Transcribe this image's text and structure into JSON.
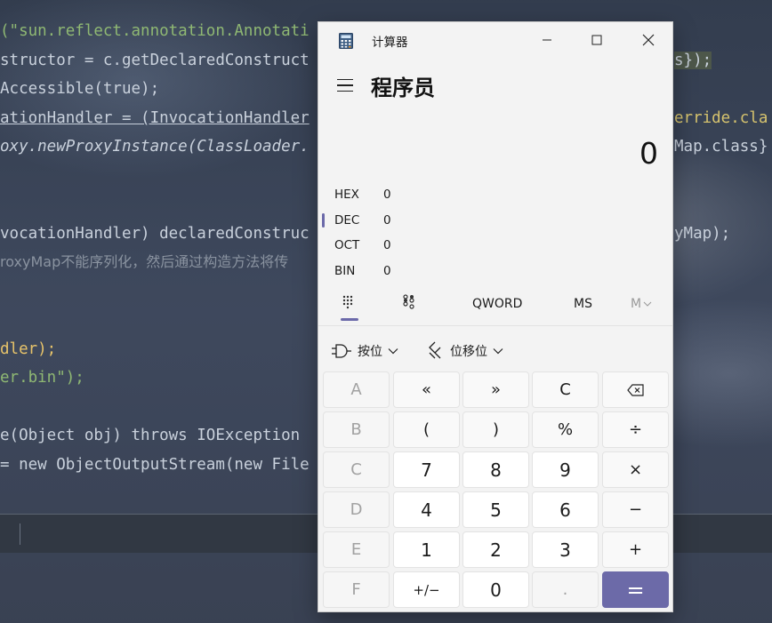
{
  "ide": {
    "lines": [
      {
        "text": "(\"sun.reflect.annotation.Annotati"
      },
      {
        "text": "structor = c.getDeclaredConstruct"
      },
      {
        "text": "Accessible(true);"
      },
      {
        "text": "ationHandler = (InvocationHandler"
      },
      {
        "text": "oxy.newProxyInstance(ClassLoader."
      },
      {
        "text": "vocationHandler) declaredConstruc"
      },
      {
        "text": "roxyMap不能序列化，然后通过构造方法将传"
      },
      {
        "text": "dler);"
      },
      {
        "text": "er.bin\");"
      },
      {
        "text": "e(Object obj) throws IOException"
      },
      {
        "text": "= new ObjectOutputStream(new File"
      }
    ],
    "right_fragments": {
      "r1": "s});",
      "r2": "erride.cla",
      "r3": "Map.class}",
      "r4": "yMap);"
    }
  },
  "calculator": {
    "window_title": "计算器",
    "mode_title": "程序员",
    "display_value": "0",
    "radix": [
      {
        "label": "HEX",
        "value": "0",
        "active": false
      },
      {
        "label": "DEC",
        "value": "0",
        "active": true
      },
      {
        "label": "OCT",
        "value": "0",
        "active": false
      },
      {
        "label": "BIN",
        "value": "0",
        "active": false
      }
    ],
    "memory": {
      "word_size": "QWORD",
      "ms": "MS",
      "mv": "M"
    },
    "dropdowns": {
      "bitwise": "按位",
      "bitshift": "位移位"
    },
    "keys": {
      "a": "A",
      "lshift": "«",
      "rshift": "»",
      "clear": "C",
      "backspace": "⌫",
      "b": "B",
      "lparen": "(",
      "rparen": ")",
      "percent": "%",
      "divide": "÷",
      "c": "C",
      "seven": "7",
      "eight": "8",
      "nine": "9",
      "multiply": "×",
      "d": "D",
      "four": "4",
      "five": "5",
      "six": "6",
      "minus": "−",
      "e": "E",
      "one": "1",
      "two": "2",
      "three": "3",
      "plus": "+",
      "f": "F",
      "negate": "+/−",
      "zero": "0",
      "decimal": ".",
      "equals": "="
    },
    "colors": {
      "accent": "#6b69a9",
      "window_bg": "#f3f3f3"
    }
  }
}
